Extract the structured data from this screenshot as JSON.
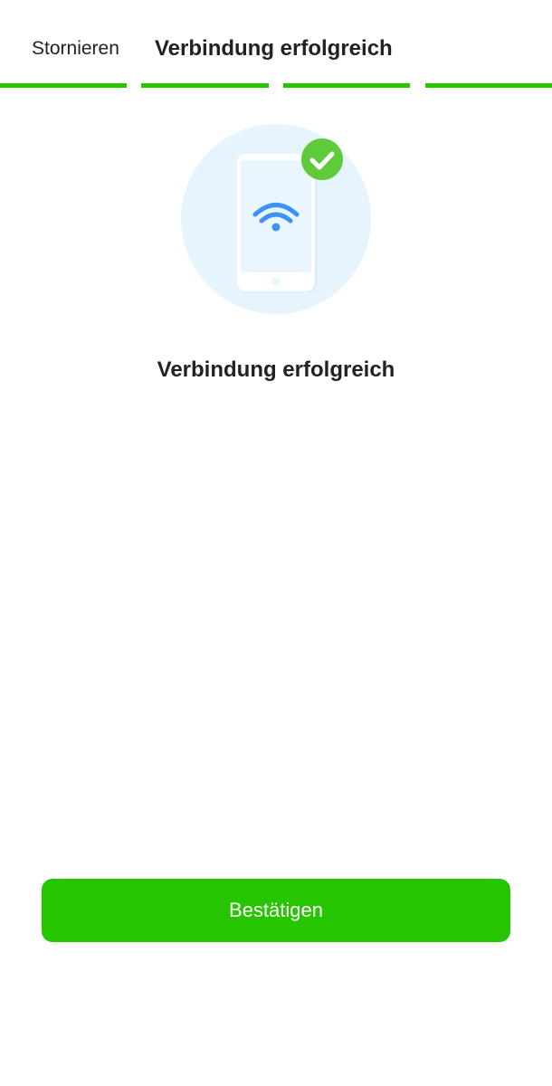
{
  "header": {
    "cancel_label": "Stornieren",
    "title": "Verbindung erfolgreich"
  },
  "progress": {
    "steps_total": 4,
    "steps_completed": 4
  },
  "illustration": {
    "icons": [
      "smartphone-icon",
      "wifi-icon",
      "check-circle-icon"
    ]
  },
  "main": {
    "status_title": "Verbindung erfolgreich"
  },
  "footer": {
    "confirm_label": "Bestätigen"
  },
  "colors": {
    "accent_green": "#26C500",
    "check_green": "#5FCB3A",
    "wifi_blue": "#3D93F5",
    "circle_bg": "#E6F5FD",
    "phone_screen": "#EAF6FE",
    "text_dark": "#222222"
  }
}
